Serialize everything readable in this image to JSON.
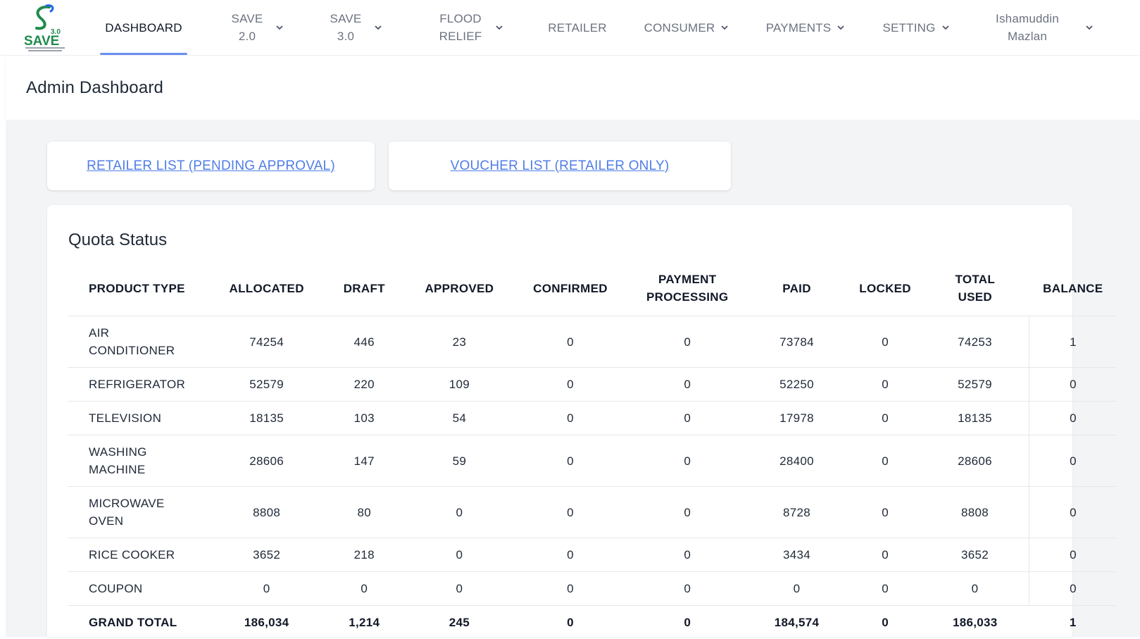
{
  "nav": {
    "logo_text": "SAVE",
    "logo_version": "3.0",
    "items": [
      {
        "label": "DASHBOARD",
        "has_dropdown": false,
        "active": true
      },
      {
        "label": "SAVE 2.0",
        "has_dropdown": true
      },
      {
        "label": "SAVE 3.0",
        "has_dropdown": true
      },
      {
        "label": "FLOOD RELIEF",
        "has_dropdown": true
      },
      {
        "label": "RETAILER",
        "has_dropdown": false
      },
      {
        "label": "CONSUMER",
        "has_dropdown": true
      },
      {
        "label": "PAYMENTS",
        "has_dropdown": true
      },
      {
        "label": "SETTING",
        "has_dropdown": true
      }
    ],
    "user": {
      "name": "Ishamuddin Mazlan"
    }
  },
  "header": {
    "title": "Admin Dashboard"
  },
  "links": {
    "retailer_pending": "RETAILER LIST (PENDING APPROVAL)",
    "voucher_list": "VOUCHER LIST (RETAILER ONLY)"
  },
  "quota": {
    "title": "Quota Status",
    "columns": [
      "PRODUCT TYPE",
      "ALLOCATED",
      "DRAFT",
      "APPROVED",
      "CONFIRMED",
      "PAYMENT PROCESSING",
      "PAID",
      "LOCKED",
      "TOTAL USED",
      "BALANCE"
    ],
    "rows": [
      [
        "AIR CONDITIONER",
        "74254",
        "446",
        "23",
        "0",
        "0",
        "73784",
        "0",
        "74253",
        "1"
      ],
      [
        "REFRIGERATOR",
        "52579",
        "220",
        "109",
        "0",
        "0",
        "52250",
        "0",
        "52579",
        "0"
      ],
      [
        "TELEVISION",
        "18135",
        "103",
        "54",
        "0",
        "0",
        "17978",
        "0",
        "18135",
        "0"
      ],
      [
        "WASHING MACHINE",
        "28606",
        "147",
        "59",
        "0",
        "0",
        "28400",
        "0",
        "28606",
        "0"
      ],
      [
        "MICROWAVE OVEN",
        "8808",
        "80",
        "0",
        "0",
        "0",
        "8728",
        "0",
        "8808",
        "0"
      ],
      [
        "RICE COOKER",
        "3652",
        "218",
        "0",
        "0",
        "0",
        "3434",
        "0",
        "3652",
        "0"
      ],
      [
        "COUPON",
        "0",
        "0",
        "0",
        "0",
        "0",
        "0",
        "0",
        "0",
        "0"
      ]
    ],
    "total": [
      "GRAND TOTAL",
      "186,034",
      "1,214",
      "245",
      "0",
      "0",
      "184,574",
      "0",
      "186,033",
      "1"
    ]
  },
  "colors": {
    "accent": "#4f7de8",
    "active_underline": "#6b8ff0",
    "logo_green": "#1f8a4c",
    "content_bg": "#f3f4f6"
  }
}
